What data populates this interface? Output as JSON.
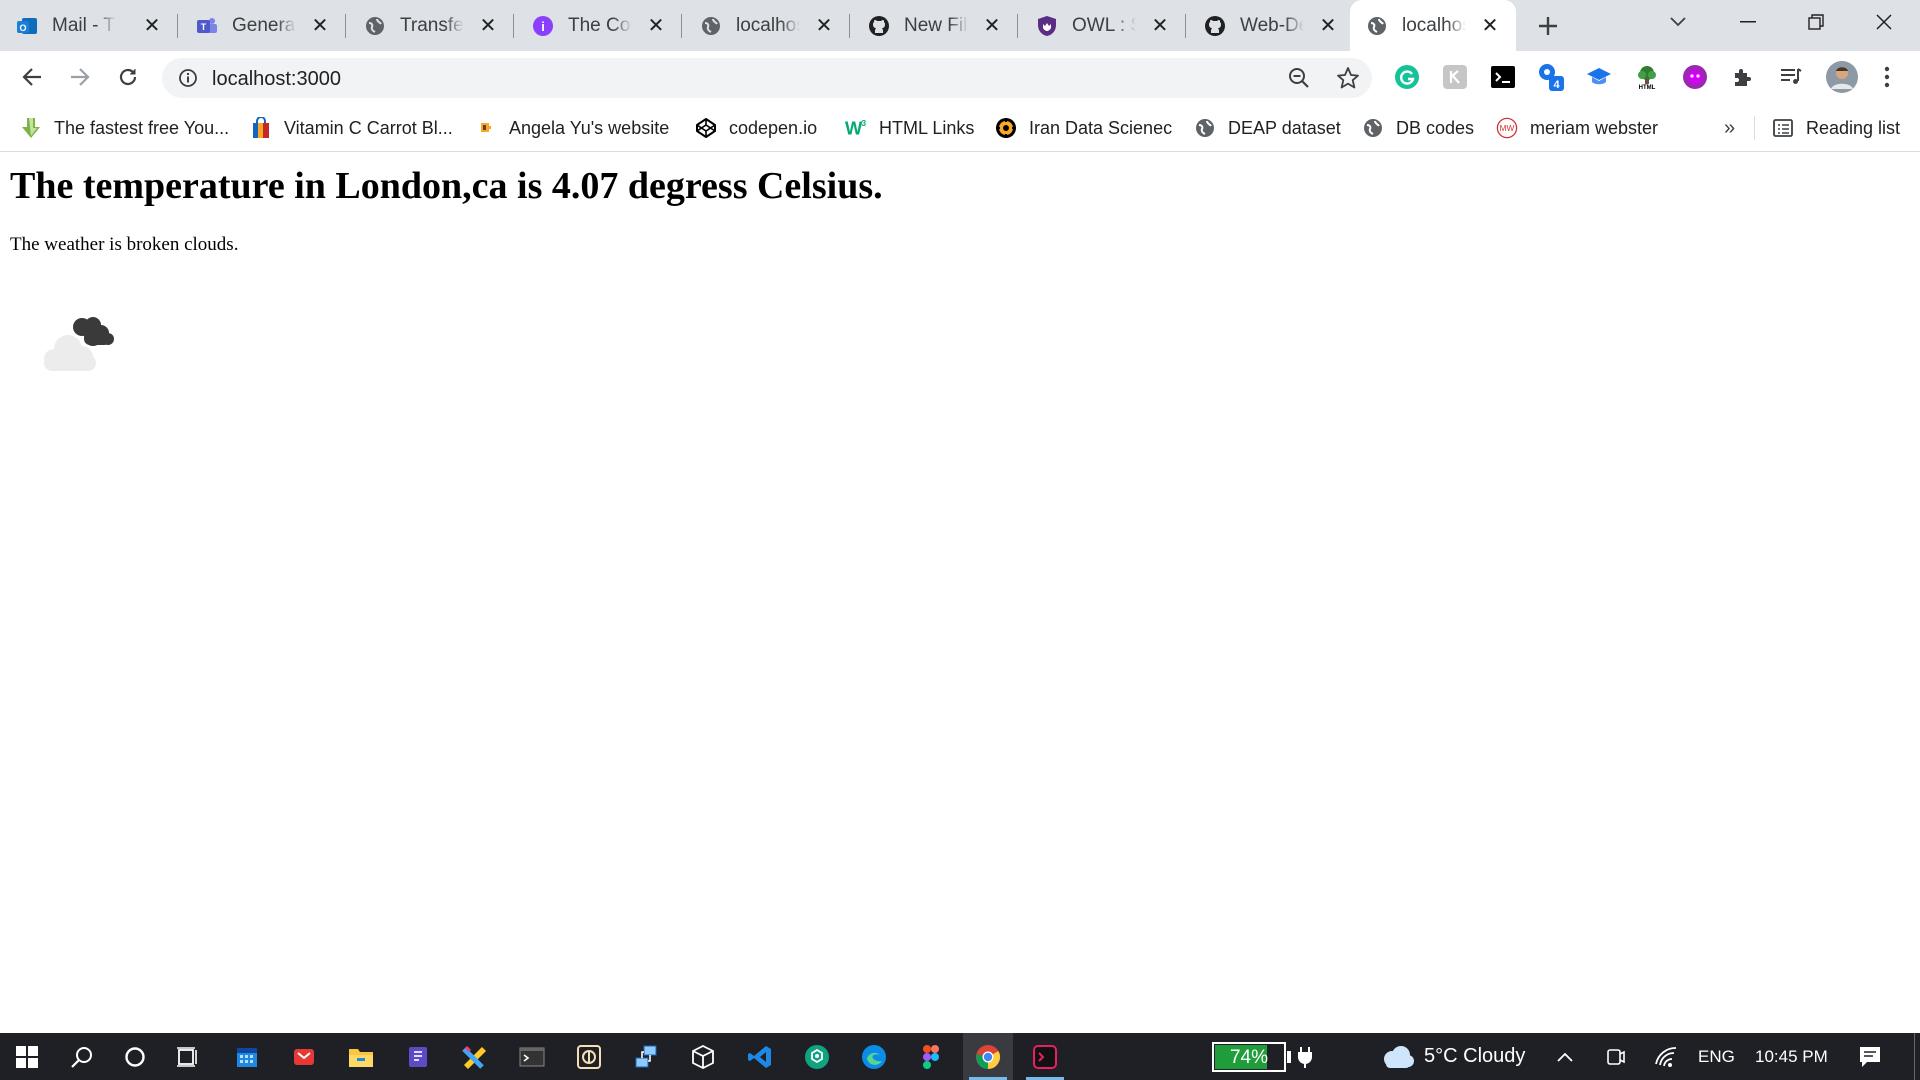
{
  "tabs": [
    {
      "title": "Mail - Tir",
      "icon": "outlook-icon"
    },
    {
      "title": "General (",
      "icon": "teams-icon"
    },
    {
      "title": "Transfer I",
      "icon": "globe-icon"
    },
    {
      "title": "The Com",
      "icon": "purple-circle-icon"
    },
    {
      "title": "localhost",
      "icon": "globe-icon"
    },
    {
      "title": "New File",
      "icon": "github-icon"
    },
    {
      "title": "OWL : SE",
      "icon": "shield-icon"
    },
    {
      "title": "Web-Dev",
      "icon": "github-icon"
    },
    {
      "title": "localhost",
      "icon": "globe-icon",
      "active": true
    }
  ],
  "address_bar": {
    "url": "localhost:3000"
  },
  "extensions": {
    "badge_count": "4"
  },
  "bookmarks": [
    {
      "label": "The fastest free You...",
      "icon": "download-arrow-icon"
    },
    {
      "label": "Vitamin C Carrot Bl...",
      "icon": "shopping-bag-icon"
    },
    {
      "label": "Angela Yu's website",
      "icon": "small-bookmark-icon"
    },
    {
      "label": "codepen.io",
      "icon": "codepen-icon"
    },
    {
      "label": "HTML Links",
      "icon": "w3schools-icon"
    },
    {
      "label": "Iran Data Scienec",
      "icon": "gear-logo-icon"
    },
    {
      "label": "DEAP dataset",
      "icon": "globe-icon"
    },
    {
      "label": "DB codes",
      "icon": "globe-icon"
    },
    {
      "label": "meriam webster",
      "icon": "mw-icon"
    }
  ],
  "bookmarks_overflow": "»",
  "reading_list": "Reading list",
  "page": {
    "heading": "The temperature in London,ca is 4.07 degress Celsius.",
    "description": "The weather is broken clouds.",
    "weather_icon": "broken-clouds-icon"
  },
  "taskbar": {
    "battery": "74%",
    "weather": "5°C  Cloudy",
    "language": "ENG",
    "time": "10:45 PM"
  },
  "colors": {
    "tab_strip": "#dee1e6",
    "omnibox": "#f1f3f4",
    "taskbar": "#1f2025",
    "battery_fill": "#1e9d3a"
  }
}
